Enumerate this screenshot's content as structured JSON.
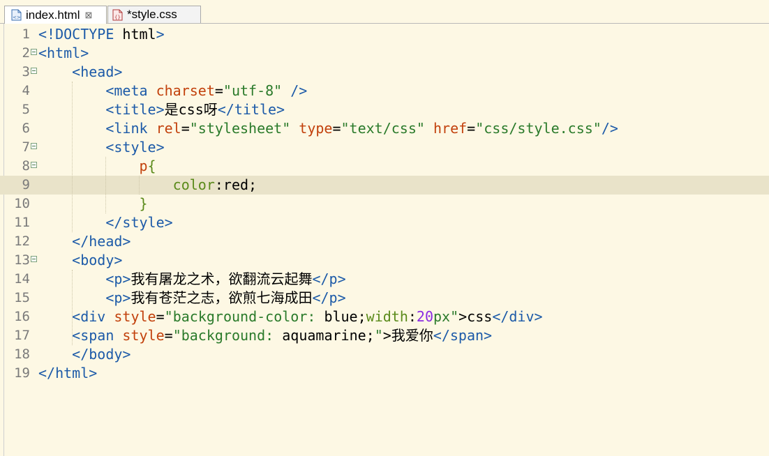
{
  "tabs": [
    {
      "label": "index.html",
      "close": "⊠",
      "active": true
    },
    {
      "label": "*style.css",
      "active": false
    }
  ],
  "lines": [
    {
      "n": "1",
      "fold": false,
      "segs": [
        [
          "t",
          "<!DOCTYPE "
        ],
        [
          "b",
          "html"
        ],
        [
          "t",
          ">"
        ]
      ]
    },
    {
      "n": "2",
      "fold": true,
      "segs": [
        [
          "t",
          "<html>"
        ]
      ]
    },
    {
      "n": "3",
      "fold": true,
      "segs": [
        [
          "b",
          "    "
        ],
        [
          "t",
          "<head>"
        ]
      ]
    },
    {
      "n": "4",
      "fold": false,
      "segs": [
        [
          "b",
          "        "
        ],
        [
          "t",
          "<meta "
        ],
        [
          "a",
          "charset"
        ],
        [
          "b",
          "="
        ],
        [
          "s",
          "\"utf-8\""
        ],
        [
          "b",
          " "
        ],
        [
          "t",
          "/>"
        ]
      ]
    },
    {
      "n": "5",
      "fold": false,
      "segs": [
        [
          "b",
          "        "
        ],
        [
          "t",
          "<title>"
        ],
        [
          "zh",
          "是"
        ],
        [
          "b",
          "css"
        ],
        [
          "zh",
          "呀"
        ],
        [
          "t",
          "</title>"
        ]
      ]
    },
    {
      "n": "6",
      "fold": false,
      "segs": [
        [
          "b",
          "        "
        ],
        [
          "t",
          "<link "
        ],
        [
          "a",
          "rel"
        ],
        [
          "b",
          "="
        ],
        [
          "s",
          "\"stylesheet\""
        ],
        [
          "b",
          " "
        ],
        [
          "a",
          "type"
        ],
        [
          "b",
          "="
        ],
        [
          "s",
          "\"text/css\""
        ],
        [
          "b",
          " "
        ],
        [
          "a",
          "href"
        ],
        [
          "b",
          "="
        ],
        [
          "s",
          "\"css/style.css\""
        ],
        [
          "t",
          "/>"
        ]
      ]
    },
    {
      "n": "7",
      "fold": true,
      "segs": [
        [
          "b",
          "        "
        ],
        [
          "t",
          "<style>"
        ]
      ]
    },
    {
      "n": "8",
      "fold": true,
      "segs": [
        [
          "b",
          "            "
        ],
        [
          "a",
          "p"
        ],
        [
          "p",
          "{"
        ]
      ]
    },
    {
      "n": "9",
      "fold": false,
      "hl": true,
      "segs": [
        [
          "b",
          "                "
        ],
        [
          "p",
          "color"
        ],
        [
          "b",
          ":red;"
        ]
      ]
    },
    {
      "n": "10",
      "fold": false,
      "segs": [
        [
          "b",
          "            "
        ],
        [
          "p",
          "}"
        ]
      ]
    },
    {
      "n": "11",
      "fold": false,
      "segs": [
        [
          "b",
          "        "
        ],
        [
          "t",
          "</style>"
        ]
      ]
    },
    {
      "n": "12",
      "fold": false,
      "segs": [
        [
          "b",
          "    "
        ],
        [
          "t",
          "</head>"
        ]
      ]
    },
    {
      "n": "13",
      "fold": true,
      "segs": [
        [
          "b",
          "    "
        ],
        [
          "t",
          "<body>"
        ]
      ]
    },
    {
      "n": "14",
      "fold": false,
      "segs": [
        [
          "b",
          "        "
        ],
        [
          "t",
          "<p>"
        ],
        [
          "zh",
          "我有屠龙之术，欲翻流云起舞"
        ],
        [
          "t",
          "</p>"
        ]
      ]
    },
    {
      "n": "15",
      "fold": false,
      "segs": [
        [
          "b",
          "        "
        ],
        [
          "t",
          "<p>"
        ],
        [
          "zh",
          "我有苍茫之志，欲煎七海成田"
        ],
        [
          "t",
          "</p>"
        ]
      ]
    },
    {
      "n": "16",
      "fold": false,
      "segs": [
        [
          "b",
          "    "
        ],
        [
          "t",
          "<div "
        ],
        [
          "a",
          "style"
        ],
        [
          "b",
          "="
        ],
        [
          "s",
          "\"background-color: "
        ],
        [
          "b",
          "blue;"
        ],
        [
          "p",
          "width"
        ],
        [
          "b",
          ":"
        ],
        [
          "n",
          "20"
        ],
        [
          "s",
          "px\""
        ],
        [
          "b",
          ">css"
        ],
        [
          "t",
          "</div>"
        ]
      ]
    },
    {
      "n": "17",
      "fold": false,
      "segs": [
        [
          "b",
          "    "
        ],
        [
          "t",
          "<span "
        ],
        [
          "a",
          "style"
        ],
        [
          "b",
          "="
        ],
        [
          "s",
          "\"background: "
        ],
        [
          "b",
          "aquamarine;"
        ],
        [
          "s",
          "\""
        ],
        [
          "b",
          ">"
        ],
        [
          "zh",
          "我爱你"
        ],
        [
          "t",
          "</span>"
        ]
      ]
    },
    {
      "n": "18",
      "fold": false,
      "segs": [
        [
          "b",
          "    "
        ],
        [
          "t",
          "</body>"
        ]
      ]
    },
    {
      "n": "19",
      "fold": false,
      "segs": [
        [
          "t",
          "</html>"
        ]
      ]
    }
  ]
}
